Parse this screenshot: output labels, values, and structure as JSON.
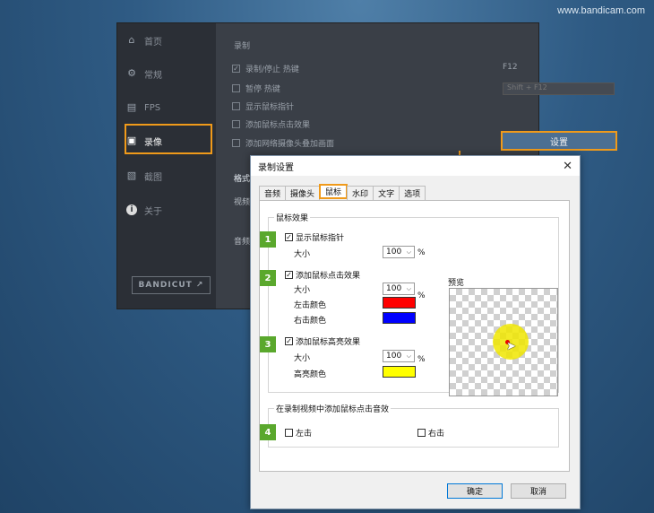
{
  "watermark": "www.bandicam.com",
  "bg_window": {
    "nav": [
      {
        "label": "首页",
        "icon": "home-icon"
      },
      {
        "label": "常规",
        "icon": "gear-icon"
      },
      {
        "label": "FPS",
        "icon": "fps-icon"
      },
      {
        "label": "录像",
        "icon": "video-settings-icon"
      },
      {
        "label": "截图",
        "icon": "image-icon"
      },
      {
        "label": "关于",
        "icon": "info-icon"
      }
    ],
    "bandicut": "BANDICUT ↗",
    "section_label": "录制",
    "options": [
      "录制/停止 热键",
      "暂停 热键",
      "显示鼠标指针",
      "添加鼠标点击效果",
      "添加网络摄像头叠加画面"
    ],
    "hotkey1": "F12",
    "hotkey2": "Shift + F12",
    "settings_button": "设置",
    "format_label": "格式",
    "video_label": "视频",
    "audio_label": "音频"
  },
  "dialog": {
    "title": "录制设置",
    "tabs": [
      "音频",
      "摄像头",
      "鼠标",
      "水印",
      "文字",
      "选项"
    ],
    "active_tab": "鼠标",
    "mouse_effects_title": "鼠标效果",
    "badges": [
      "1",
      "2",
      "3",
      "4"
    ],
    "show_pointer": {
      "label": "显示鼠标指针",
      "checked": true,
      "size_label": "大小",
      "size_value": "100"
    },
    "click_effect": {
      "label": "添加鼠标点击效果",
      "checked": true,
      "size_label": "大小",
      "size_value": "100",
      "left_label": "左击颜色",
      "right_label": "右击颜色",
      "left_color": "#ff0000",
      "right_color": "#0000ff"
    },
    "highlight_effect": {
      "label": "添加鼠标高亮效果",
      "checked": true,
      "size_label": "大小",
      "size_value": "100",
      "color_label": "高亮颜色",
      "color": "#ffff00"
    },
    "percent": "%",
    "preview_label": "预览",
    "sound_title": "在录制视频中添加鼠标点击音效",
    "left_click": "左击",
    "right_click": "右击",
    "ok_button": "确定",
    "cancel_button": "取消"
  }
}
